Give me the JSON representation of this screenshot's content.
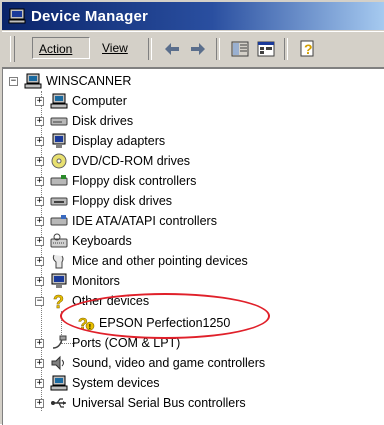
{
  "window": {
    "title": "Device Manager"
  },
  "toolbar": {
    "action_label": "Action",
    "view_label": "View"
  },
  "tree": {
    "root": "WINSCANNER",
    "items": [
      {
        "label": "Computer",
        "icon": "computer-icon"
      },
      {
        "label": "Disk drives",
        "icon": "disk-drive-icon"
      },
      {
        "label": "Display adapters",
        "icon": "display-adapter-icon"
      },
      {
        "label": "DVD/CD-ROM drives",
        "icon": "dvd-drive-icon"
      },
      {
        "label": "Floppy disk controllers",
        "icon": "floppy-controller-icon"
      },
      {
        "label": "Floppy disk drives",
        "icon": "floppy-drive-icon"
      },
      {
        "label": "IDE ATA/ATAPI controllers",
        "icon": "ide-controller-icon"
      },
      {
        "label": "Keyboards",
        "icon": "keyboard-icon"
      },
      {
        "label": "Mice and other pointing devices",
        "icon": "mouse-icon"
      },
      {
        "label": "Monitors",
        "icon": "monitor-icon"
      },
      {
        "label": "Other devices",
        "icon": "unknown-device-icon",
        "expanded": true,
        "children": [
          {
            "label": "EPSON Perfection1250",
            "icon": "warning-device-icon"
          }
        ]
      },
      {
        "label": "Ports (COM & LPT)",
        "icon": "port-icon"
      },
      {
        "label": "Sound, video and game controllers",
        "icon": "sound-icon"
      },
      {
        "label": "System devices",
        "icon": "system-device-icon"
      },
      {
        "label": "Universal Serial Bus controllers",
        "icon": "usb-icon"
      }
    ]
  },
  "colors": {
    "title_start": "#0a246a",
    "title_end": "#a6caf0",
    "highlight": "#e0202a"
  }
}
